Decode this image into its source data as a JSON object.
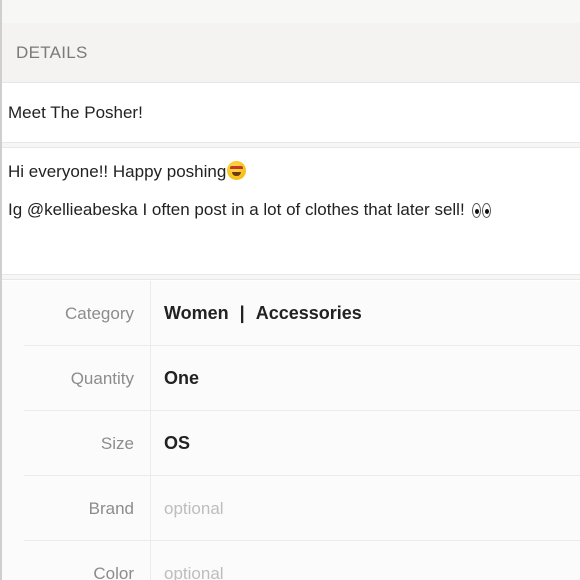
{
  "section": {
    "header": "DETAILS"
  },
  "listing": {
    "title": "Meet The Posher!",
    "description_line1": "Hi everyone!! Happy poshing",
    "description_line2": "Ig @kellieabeska I often post in a lot of clothes that later sell! ",
    "icons": [
      "star-struck-emoji-icon",
      "eyes-emoji-icon"
    ]
  },
  "attributes": {
    "category": {
      "label": "Category",
      "value_main": "Women",
      "separator": "|",
      "value_sub": "Accessories"
    },
    "quantity": {
      "label": "Quantity",
      "value": "One"
    },
    "size": {
      "label": "Size",
      "value": "OS"
    },
    "brand": {
      "label": "Brand",
      "placeholder": "optional"
    },
    "color": {
      "label": "Color",
      "placeholder": "optional"
    }
  },
  "colors": {
    "header_bg": "#f4f3f1",
    "label_text": "#8c8c8c",
    "placeholder_text": "#bdbdbd",
    "value_text": "#222222"
  }
}
